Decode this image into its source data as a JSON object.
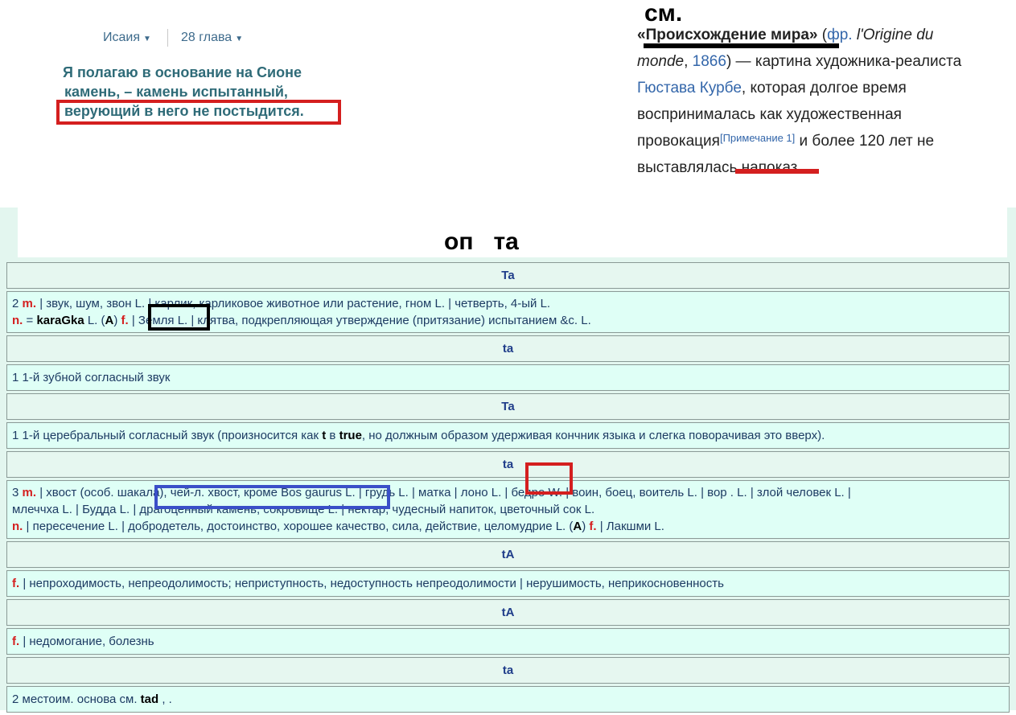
{
  "bible": {
    "book": "Исаия",
    "chapter": "28 глава",
    "verse_lines": [
      "Я полагаю в основание на Сионе",
      "камень, – камень испытанный,",
      "верующий в него не постыдится."
    ]
  },
  "overlay": {
    "sm": "см.",
    "op_ta": "оп   та"
  },
  "wiki": {
    "title_quote": "«Происхождение мира»",
    "open_paren": " (",
    "fr": "фр.",
    "fr_italic": " l'Origine du monde",
    "comma": ", ",
    "year": "1866",
    "after_year": ") — картина художника-реалиста ",
    "artist": "Гюстава Курбе",
    "rest1": ", которая долгое время воспринималась как художественная провокация",
    "note": "[Примечание 1]",
    "rest2": " и более 120 лет не выставлялась напоказ."
  },
  "colors": {
    "red_box": "#d41f1f",
    "black_box": "#000000",
    "blue_box": "#3a4fc8",
    "nav_text": "#3e6b8c",
    "verse_text": "#2f6b78"
  },
  "dictionary": [
    {
      "head": "Ta",
      "body": [
        [
          {
            "t": "2 "
          },
          {
            "t": "m.",
            "c": "red"
          },
          {
            "t": " | звук, шум, звон L. | карлик, карликовое животное или растение, гном L. | четверть, 4-ый L."
          }
        ],
        [
          {
            "t": "n.",
            "c": "red"
          },
          {
            "t": " = "
          },
          {
            "t": "karaGka",
            "c": "blk"
          },
          {
            "t": " L. ("
          },
          {
            "t": "A",
            "c": "blk"
          },
          {
            "t": ") "
          },
          {
            "t": "f.",
            "c": "red"
          },
          {
            "t": " | Земля L. | клятва, подкрепляющая утверждение (притязание) испытанием &c. L."
          }
        ]
      ]
    },
    {
      "head": "ta",
      "body": [
        [
          {
            "t": "1 1-й зубной согласный звук"
          }
        ]
      ]
    },
    {
      "head": "Ta",
      "body": [
        [
          {
            "t": "1 1-й церебральный согласный звук (произносится как "
          },
          {
            "t": "t",
            "c": "blk"
          },
          {
            "t": " в "
          },
          {
            "t": "true",
            "c": "blk"
          },
          {
            "t": ", но должным образом удерживая кончник языка и слегка поворачивая это вверх)."
          }
        ]
      ]
    },
    {
      "head": "ta",
      "body": [
        [
          {
            "t": "3 "
          },
          {
            "t": "m.",
            "c": "red"
          },
          {
            "t": " | хвост (особ. шакала), чей-л. хвост, кроме Bos gaurus L. | грудь L. | матка | лоно L. | бедро W. | воин, боец, воитель L. | вор . L. | злой человек L. |"
          }
        ],
        [
          {
            "t": "млеччха L. | Будда L. | драгоценный камень, сокровище L. | нектар, чудесный напиток, цветочный сок L."
          }
        ],
        [
          {
            "t": "n.",
            "c": "red"
          },
          {
            "t": " | пересечение L. | добродетель, достоинство, хорошее качество, сила, действие, целомудрие L. ("
          },
          {
            "t": "A",
            "c": "blk"
          },
          {
            "t": ") "
          },
          {
            "t": "f.",
            "c": "red"
          },
          {
            "t": " | Лакшми L."
          }
        ]
      ]
    },
    {
      "head": "tA",
      "body": [
        [
          {
            "t": "f.",
            "c": "red"
          },
          {
            "t": " | непроходимость, непреодолимость; неприступность, недоступность непреодолимости | нерушимость, неприкосновенность"
          }
        ]
      ]
    },
    {
      "head": "tA",
      "body": [
        [
          {
            "t": "f.",
            "c": "red"
          },
          {
            "t": " | недомогание, болезнь"
          }
        ]
      ]
    },
    {
      "head": "ta",
      "body": [
        [
          {
            "t": "2 местоим. основа см. "
          },
          {
            "t": "tad",
            "c": "blk"
          },
          {
            "t": " , ."
          }
        ]
      ]
    }
  ]
}
